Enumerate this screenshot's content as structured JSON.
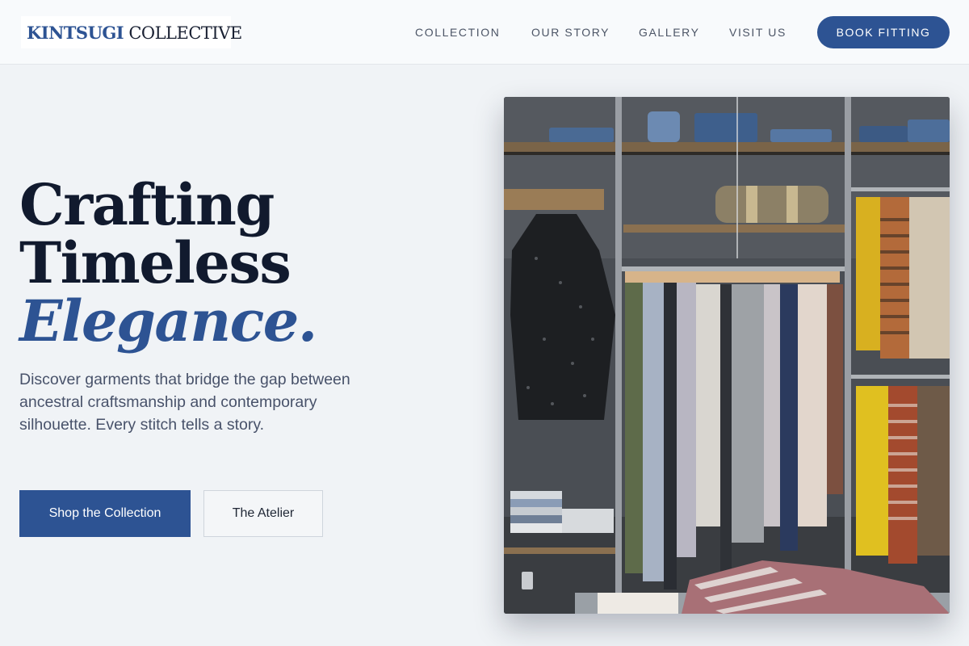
{
  "brand": {
    "strong": "KINTSUGI",
    "light": "COLLECTIVE"
  },
  "nav": {
    "items": [
      "COLLECTION",
      "OUR STORY",
      "GALLERY",
      "VISIT US"
    ],
    "cta": "BOOK FITTING"
  },
  "hero": {
    "line1": "Crafting",
    "line2": "Timeless",
    "line3": "Elegance.",
    "lede": "Discover garments that bridge the gap between ancestral craftsmanship and contemporary silhouette. Every stitch tells a story.",
    "primary_cta": "Shop the Collection",
    "secondary_cta": "The Atelier"
  },
  "colors": {
    "accent": "#2d5393",
    "heading": "#111a2e",
    "background": "#f0f3f6"
  }
}
